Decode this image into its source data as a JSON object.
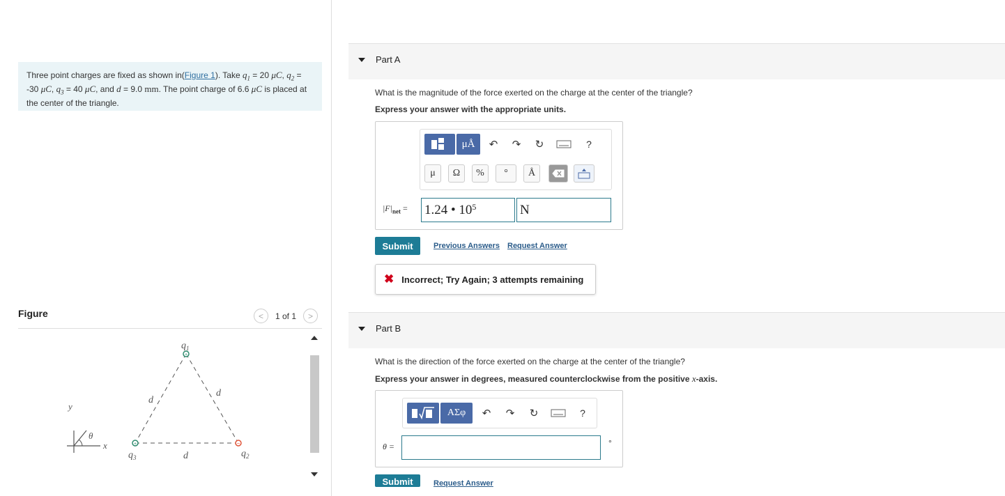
{
  "problem": {
    "text_1": "Three point charges are fixed as shown in(",
    "figure_link": "Figure 1",
    "text_2": "). Take ",
    "q1_sym": "q",
    "q1_sub": "1",
    "q1_val": " = 20 ",
    "unit_uC": "μC",
    "q2_sym": "q",
    "q2_sub": "2",
    "q2_val": " = -30 ",
    "q3_sym": "q",
    "q3_sub": "3",
    "q3_val": " = 40 ",
    "text_3": ", and ",
    "d_sym": "d",
    "d_val": " = 9.0 ",
    "unit_mm": "mm",
    "text_4": ". The point charge of 6.6 ",
    "text_5": " is placed at the center of the triangle."
  },
  "figure": {
    "title": "Figure",
    "pager": "1 of 1",
    "labels": {
      "q1": "q",
      "q1_sub": "1",
      "q2": "q",
      "q2_sub": "2",
      "q3": "q",
      "q3_sub": "3",
      "d": "d",
      "x": "x",
      "y": "y",
      "theta": "θ"
    }
  },
  "partA": {
    "label": "Part A",
    "question": "What is the magnitude of the force exerted on the charge at the center of the triangle?",
    "instruction": "Express your answer with the appropriate units.",
    "toolbar_units": "μÅ",
    "toolbar_help": "?",
    "symbols": [
      "μ",
      "Ω",
      "%",
      "°",
      "Å"
    ],
    "answer_label_F": "|F|",
    "answer_label_sub": "net",
    "answer_label_eq": "=",
    "answer_value": "1.24 • 10",
    "answer_exp": "5",
    "answer_unit": "N",
    "submit": "Submit",
    "previous_answers": "Previous Answers",
    "request_answer": "Request Answer",
    "feedback": "Incorrect; Try Again; 3 attempts remaining"
  },
  "partB": {
    "label": "Part B",
    "question": "What is the direction of the force exerted on the charge at the center of the triangle?",
    "instruction_1": "Express your answer in degrees, measured counterclockwise from the positive ",
    "instruction_x": "x",
    "instruction_2": "-axis.",
    "toolbar_greek": "ΑΣφ",
    "toolbar_help": "?",
    "answer_label": "θ =",
    "answer_value": "",
    "answer_unit": "°",
    "submit": "Submit",
    "request_answer": "Request Answer"
  },
  "colors": {
    "accent": "#1d7c96",
    "problem_bg": "#eaf4f7",
    "toolbar_blue": "#4a6aa7",
    "error": "#d0021b",
    "positive_charge": "#2e8b6e",
    "negative_charge": "#e0553a"
  }
}
